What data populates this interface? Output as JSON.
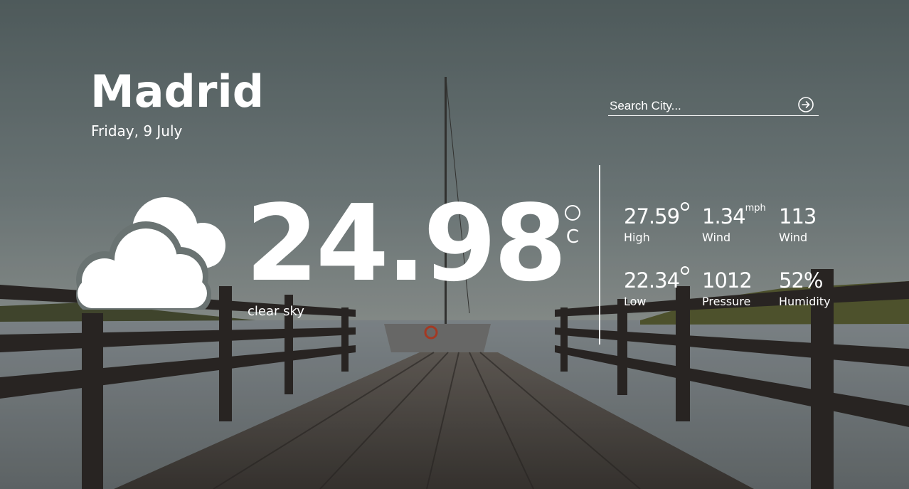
{
  "location": {
    "city": "Madrid",
    "date": "Friday, 9 July"
  },
  "search": {
    "placeholder": "Search City...",
    "button_icon": "arrow-circle-right-icon"
  },
  "current": {
    "icon": "cloudy-icon",
    "temperature": "24.98",
    "unit": "C",
    "description": "clear sky"
  },
  "stats": {
    "high": {
      "value": "27.59",
      "label": "High"
    },
    "wind_speed": {
      "value": "1.34",
      "unit": "mph",
      "label": "Wind"
    },
    "wind_deg": {
      "value": "113",
      "label": "Wind"
    },
    "low": {
      "value": "22.34",
      "label": "Low"
    },
    "pressure": {
      "value": "1012",
      "label": "Pressure"
    },
    "humidity": {
      "value": "52%",
      "label": "Humidity"
    }
  },
  "colors": {
    "text": "#ffffff",
    "sky": "#65716f",
    "water": "#8d959a",
    "dock": "#5a524a"
  }
}
